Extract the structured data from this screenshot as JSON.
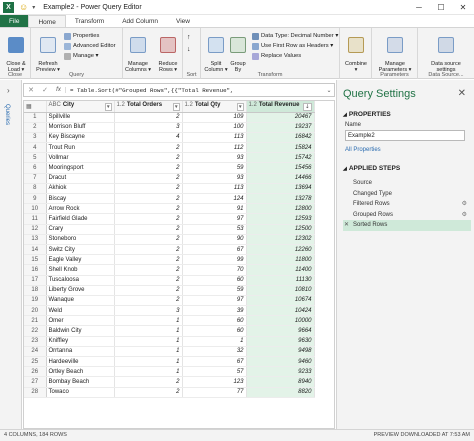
{
  "window": {
    "title": "Example2 - Power Query Editor",
    "logo_letter": "X",
    "controls": [
      "─",
      "☐",
      "✕"
    ]
  },
  "ribbon_tabs": [
    {
      "label": "File"
    },
    {
      "label": "Home"
    },
    {
      "label": "Transform"
    },
    {
      "label": "Add Column"
    },
    {
      "label": "View"
    }
  ],
  "ribbon": {
    "close": {
      "btn": "Close &\nLoad ▾",
      "group": "Close"
    },
    "query": {
      "refresh": "Refresh\nPreview ▾",
      "properties": "Properties",
      "advanced_editor": "Advanced Editor",
      "manage": "Manage ▾",
      "group": "Query"
    },
    "manage_columns": {
      "btn": "Manage\nColumns ▾"
    },
    "reduce_rows": {
      "btn": "Reduce\nRows ▾"
    },
    "sort": {
      "group": "Sort"
    },
    "transform": {
      "split": "Split\nColumn ▾",
      "group_by": "Group\nBy",
      "data_type": "Data Type: Decimal Number ▾",
      "first_row": "Use First Row as Headers ▾",
      "replace": "Replace Values",
      "group": "Transform"
    },
    "combine": {
      "btn": "Combine\n▾"
    },
    "parameters": {
      "btn": "Manage\nParameters ▾",
      "group": "Parameters"
    },
    "data_source": {
      "btn": "Data source\nsettings",
      "group": "Data Source..."
    }
  },
  "left_nav": {
    "label": "Queries"
  },
  "formula": {
    "text": "= Table.Sort(#\"Grouped Rows\",{{\"Total Revenue\","
  },
  "columns": [
    {
      "type": "ABC",
      "name": "City"
    },
    {
      "type": "1.2",
      "name": "Total Orders"
    },
    {
      "type": "1.2",
      "name": "Total Qty"
    },
    {
      "type": "1.2",
      "name": "Total Revenue"
    }
  ],
  "rows": [
    {
      "n": "1",
      "city": "Spillville",
      "orders": "2",
      "qty": "109",
      "rev": "20467"
    },
    {
      "n": "2",
      "city": "Morrison Bluff",
      "orders": "3",
      "qty": "100",
      "rev": "19237"
    },
    {
      "n": "3",
      "city": "Key Biscayne",
      "orders": "4",
      "qty": "113",
      "rev": "16842"
    },
    {
      "n": "4",
      "city": "Trout Run",
      "orders": "2",
      "qty": "112",
      "rev": "15824"
    },
    {
      "n": "5",
      "city": "Vollmar",
      "orders": "2",
      "qty": "93",
      "rev": "15742"
    },
    {
      "n": "6",
      "city": "Mooringsport",
      "orders": "2",
      "qty": "59",
      "rev": "15456"
    },
    {
      "n": "7",
      "city": "Dracut",
      "orders": "2",
      "qty": "93",
      "rev": "14466"
    },
    {
      "n": "8",
      "city": "Akhiok",
      "orders": "2",
      "qty": "113",
      "rev": "13694"
    },
    {
      "n": "9",
      "city": "Biscay",
      "orders": "2",
      "qty": "124",
      "rev": "13278"
    },
    {
      "n": "10",
      "city": "Arrow Rock",
      "orders": "2",
      "qty": "91",
      "rev": "12800"
    },
    {
      "n": "11",
      "city": "Fairfield Glade",
      "orders": "2",
      "qty": "97",
      "rev": "12593"
    },
    {
      "n": "12",
      "city": "Crary",
      "orders": "2",
      "qty": "53",
      "rev": "12500"
    },
    {
      "n": "13",
      "city": "Stoneboro",
      "orders": "2",
      "qty": "90",
      "rev": "12302"
    },
    {
      "n": "14",
      "city": "Switz City",
      "orders": "2",
      "qty": "67",
      "rev": "12260"
    },
    {
      "n": "15",
      "city": "Eagle Valley",
      "orders": "2",
      "qty": "99",
      "rev": "11800"
    },
    {
      "n": "16",
      "city": "Shell Knob",
      "orders": "2",
      "qty": "70",
      "rev": "11400"
    },
    {
      "n": "17",
      "city": "Tuscaloosa",
      "orders": "2",
      "qty": "60",
      "rev": "11130"
    },
    {
      "n": "18",
      "city": "Liberty Grove",
      "orders": "2",
      "qty": "59",
      "rev": "10810"
    },
    {
      "n": "19",
      "city": "Wanaque",
      "orders": "2",
      "qty": "97",
      "rev": "10674"
    },
    {
      "n": "20",
      "city": "Weld",
      "orders": "3",
      "qty": "39",
      "rev": "10424"
    },
    {
      "n": "21",
      "city": "Omer",
      "orders": "1",
      "qty": "60",
      "rev": "10000"
    },
    {
      "n": "22",
      "city": "Baldwin City",
      "orders": "1",
      "qty": "60",
      "rev": "9664"
    },
    {
      "n": "23",
      "city": "Kniffley",
      "orders": "1",
      "qty": "1",
      "rev": "9630"
    },
    {
      "n": "24",
      "city": "Orrtanna",
      "orders": "1",
      "qty": "32",
      "rev": "9498"
    },
    {
      "n": "25",
      "city": "Hardeeville",
      "orders": "1",
      "qty": "67",
      "rev": "9460"
    },
    {
      "n": "26",
      "city": "Ortley Beach",
      "orders": "1",
      "qty": "57",
      "rev": "9233"
    },
    {
      "n": "27",
      "city": "Bombay Beach",
      "orders": "2",
      "qty": "123",
      "rev": "8940"
    },
    {
      "n": "28",
      "city": "Towaco",
      "orders": "2",
      "qty": "77",
      "rev": "8820"
    }
  ],
  "query_settings": {
    "title": "Query Settings",
    "properties_heading": "PROPERTIES",
    "name_label": "Name",
    "name_value": "Example2",
    "all_properties": "All Properties",
    "steps_heading": "APPLIED STEPS",
    "steps": [
      {
        "label": "Source",
        "gear": false,
        "selected": false
      },
      {
        "label": "Changed Type",
        "gear": false,
        "selected": false
      },
      {
        "label": "Filtered Rows",
        "gear": true,
        "selected": false
      },
      {
        "label": "Grouped Rows",
        "gear": true,
        "selected": false
      },
      {
        "label": "Sorted Rows",
        "gear": false,
        "selected": true
      }
    ]
  },
  "status": {
    "left": "4 COLUMNS, 184 ROWS",
    "right": "PREVIEW DOWNLOADED AT 7:53 AM"
  },
  "colors": {
    "brand": "#217346",
    "selected_bg": "#cfe9d9",
    "link": "#2b6cb0"
  }
}
